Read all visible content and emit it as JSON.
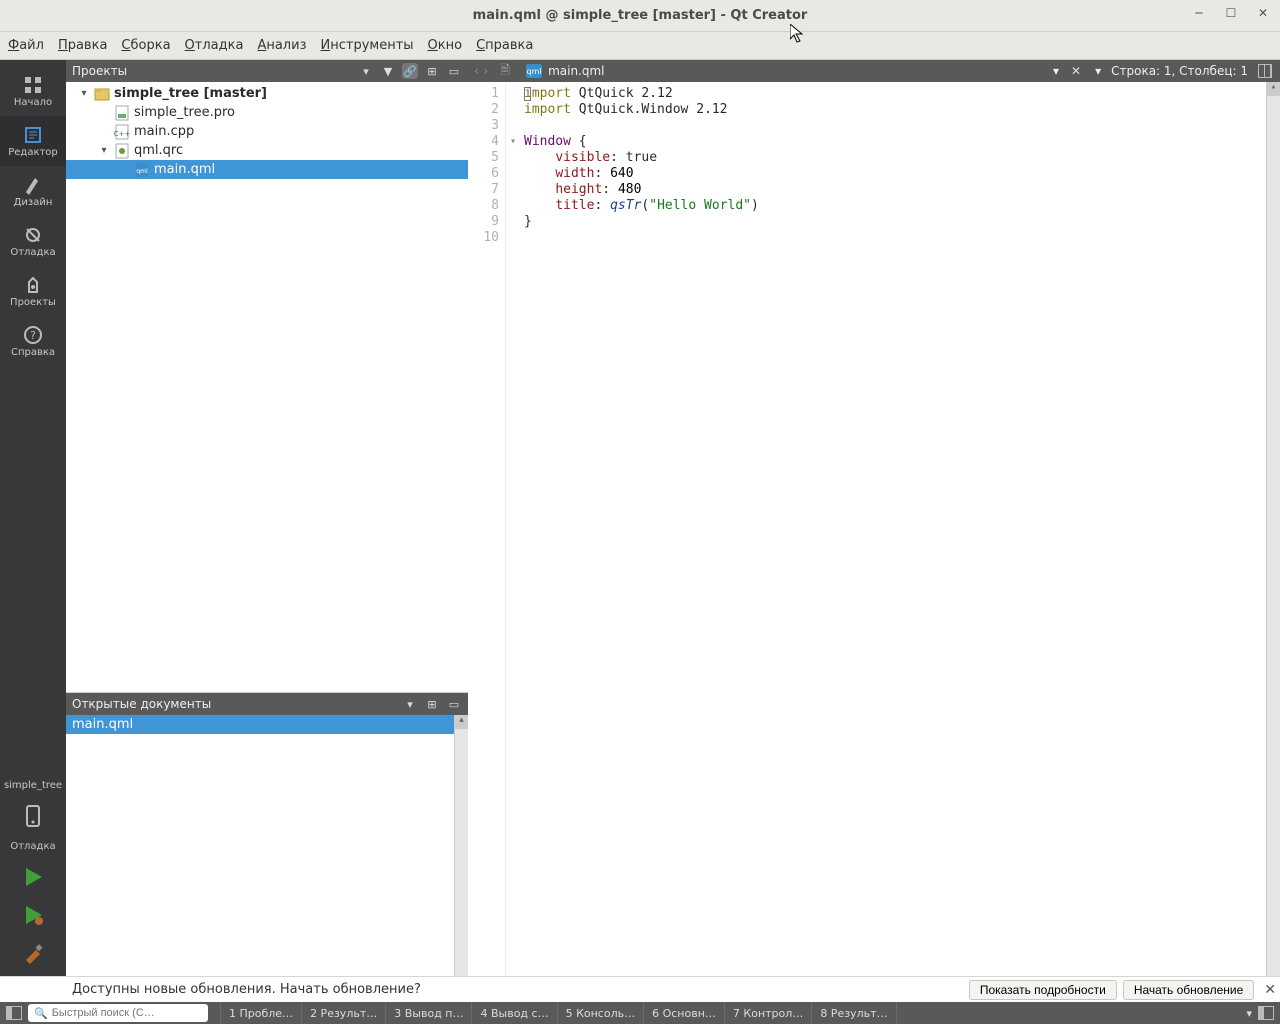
{
  "window": {
    "title": "main.qml @ simple_tree [master] - Qt Creator"
  },
  "menubar": [
    "Файл",
    "Правка",
    "Сборка",
    "Отладка",
    "Анализ",
    "Инструменты",
    "Окно",
    "Справка"
  ],
  "leftbar": {
    "modes": [
      {
        "id": "welcome",
        "label": "Начало"
      },
      {
        "id": "edit",
        "label": "Редактор"
      },
      {
        "id": "design",
        "label": "Дизайн"
      },
      {
        "id": "debug",
        "label": "Отладка"
      },
      {
        "id": "projects",
        "label": "Проекты"
      },
      {
        "id": "help",
        "label": "Справка"
      }
    ],
    "active": "edit",
    "bottom_project": "simple_tree",
    "bottom_kit": "Отладка"
  },
  "projects_panel": {
    "title": "Проекты",
    "tree": [
      {
        "depth": 0,
        "expand": "▾",
        "icon": "project-icon",
        "label": "simple_tree [master]",
        "bold": true
      },
      {
        "depth": 1,
        "expand": "",
        "icon": "pro-file-icon",
        "label": "simple_tree.pro"
      },
      {
        "depth": 1,
        "expand": "",
        "icon": "cpp-file-icon",
        "label": "main.cpp"
      },
      {
        "depth": 1,
        "expand": "▾",
        "icon": "qrc-file-icon",
        "label": "qml.qrc"
      },
      {
        "depth": 2,
        "expand": "",
        "icon": "qml-file-icon",
        "label": "main.qml",
        "selected": true
      }
    ]
  },
  "open_docs_panel": {
    "title": "Открытые документы",
    "items": [
      {
        "label": "main.qml",
        "selected": true
      }
    ]
  },
  "editor": {
    "filename": "main.qml",
    "cursor_status": "Строка: 1, Столбец: 1",
    "line_count": 10,
    "fold_line": 4,
    "code_lines": [
      [
        [
          "kw",
          "import"
        ],
        [
          "",
          ""
        ],
        [
          "",
          "QtQuick"
        ],
        [
          "",
          ""
        ],
        [
          "",
          "2.12"
        ]
      ],
      [
        [
          "kw",
          "import"
        ],
        [
          "",
          ""
        ],
        [
          "",
          "QtQuick.Window"
        ],
        [
          "",
          ""
        ],
        [
          "",
          "2.12"
        ]
      ],
      [],
      [
        [
          "type",
          "Window"
        ],
        [
          "",
          ""
        ],
        [
          "",
          "{"
        ]
      ],
      [
        [
          "",
          "    "
        ],
        [
          "prop",
          "visible"
        ],
        [
          "",
          ":"
        ],
        [
          "",
          ""
        ],
        [
          "",
          "true"
        ]
      ],
      [
        [
          "",
          "    "
        ],
        [
          "prop",
          "width"
        ],
        [
          "",
          ":"
        ],
        [
          "",
          ""
        ],
        [
          "num",
          "640"
        ]
      ],
      [
        [
          "",
          "    "
        ],
        [
          "prop",
          "height"
        ],
        [
          "",
          ":"
        ],
        [
          "",
          ""
        ],
        [
          "num",
          "480"
        ]
      ],
      [
        [
          "",
          "    "
        ],
        [
          "prop",
          "title"
        ],
        [
          "",
          ":"
        ],
        [
          "",
          ""
        ],
        [
          "fn",
          "qsTr"
        ],
        [
          "",
          "("
        ],
        [
          "str",
          "\"Hello World\""
        ],
        [
          "",
          ")"
        ]
      ],
      [
        [
          "",
          "}"
        ]
      ],
      []
    ]
  },
  "update_bar": {
    "message": "Доступны новые обновления. Начать обновление?",
    "btn_details": "Показать подробности",
    "btn_update": "Начать обновление"
  },
  "status_bar": {
    "search_placeholder": "Быстрый поиск (C…",
    "panes": [
      "1 Пробле…",
      "2 Результ…",
      "3 Вывод п…",
      "4 Вывод с…",
      "5 Консоль…",
      "6 Основн…",
      "7 Контрол…",
      "8 Результ…"
    ]
  }
}
